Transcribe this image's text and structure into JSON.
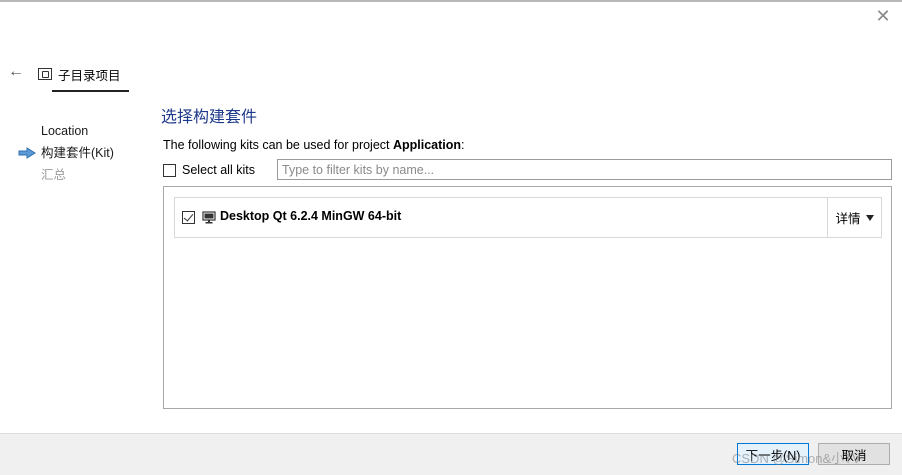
{
  "header": {
    "title": "子目录项目"
  },
  "steps": [
    {
      "label": "Location"
    },
    {
      "label": "构建套件(Kit)"
    },
    {
      "label": "汇总"
    }
  ],
  "main": {
    "title": "选择构建套件",
    "description_prefix": "The following kits can be used for project ",
    "project_name": "Application",
    "description_suffix": ":",
    "select_all_label": "Select all kits",
    "filter_placeholder": "Type to filter kits by name...",
    "kits": [
      {
        "name": "Desktop Qt 6.2.4 MinGW 64-bit",
        "checked": true,
        "details_label": "详情"
      }
    ]
  },
  "footer": {
    "next_label": "下一步(N)",
    "cancel_label": "取消"
  },
  "watermark": "CSDN @Simon&小TV",
  "colors": {
    "title": "#1e3a8a",
    "step_arrow": "#2f7dd1",
    "default_button_border": "#0078d7"
  }
}
